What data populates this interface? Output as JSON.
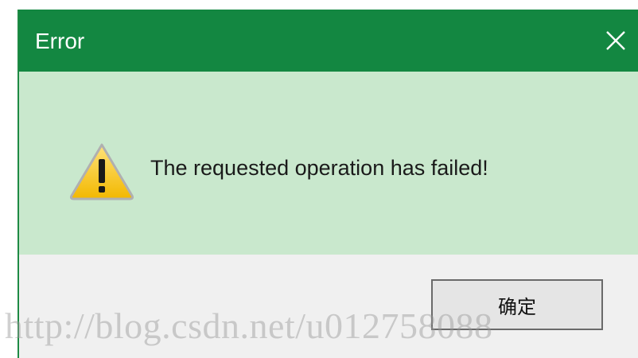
{
  "dialog": {
    "title": "Error",
    "close_icon": "close-icon",
    "warning_icon": "warning-icon",
    "message": "The requested operation has failed!",
    "ok_label": "确定"
  },
  "watermark": {
    "text": "http://blog.csdn.net/u012758088"
  },
  "colors": {
    "titlebar": "#138741",
    "content_bg": "#c9e8cd",
    "footer_bg": "#f0f0f0",
    "warning_yellow": "#f5c400"
  }
}
